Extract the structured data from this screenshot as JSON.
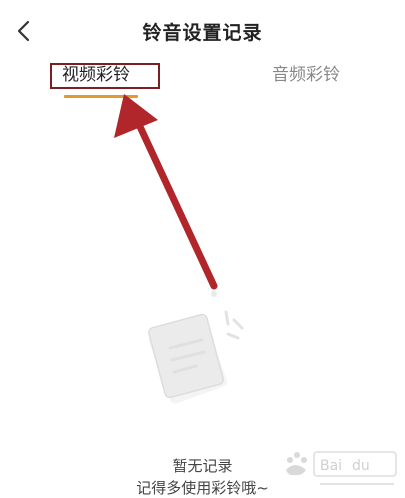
{
  "header": {
    "title": "铃音设置记录",
    "back_icon": "chevron-left-icon"
  },
  "tabs": [
    {
      "label": "视频彩铃",
      "selected": true
    },
    {
      "label": "音频彩铃",
      "selected": false
    }
  ],
  "empty_state": {
    "line1": "暂无记录",
    "line2": "记得多使用彩铃哦~",
    "icon": "empty-document-icon"
  },
  "colors": {
    "tab_indicator": "#e09a2e",
    "annotation": "#b0262a",
    "highlight_box": "#7a1f22"
  }
}
